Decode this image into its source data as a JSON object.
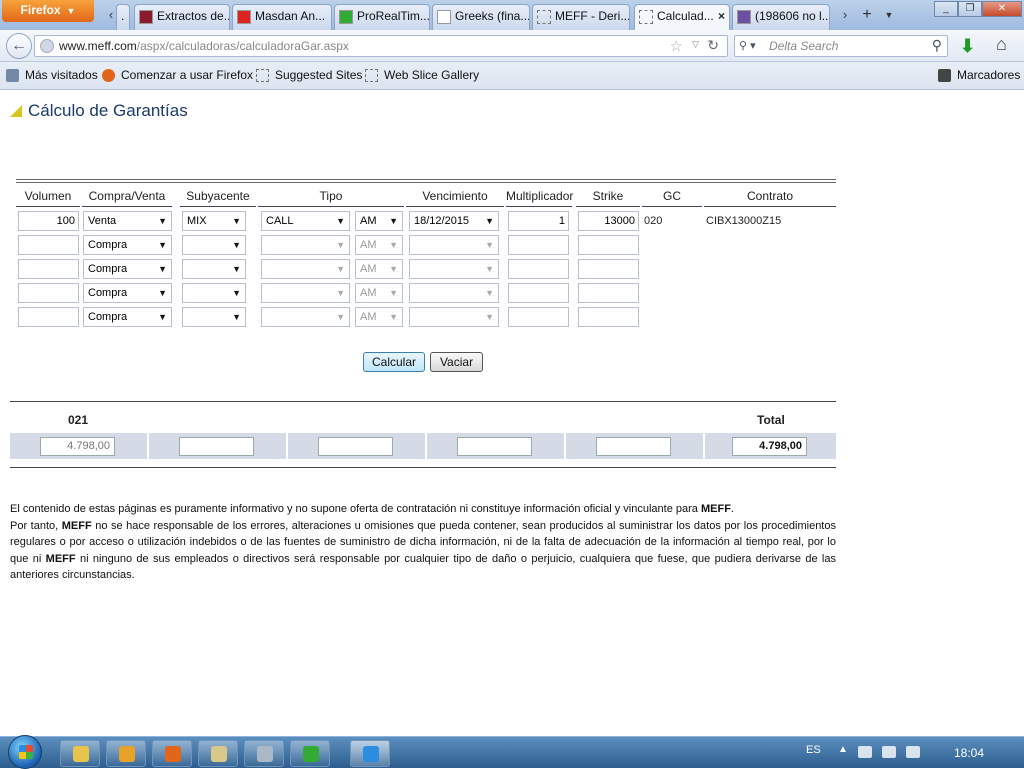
{
  "browser": {
    "firefox_menu": "Firefox",
    "tabs": [
      {
        "label": ".",
        "icon": "blank-page-icon"
      },
      {
        "label": "Extractos de...",
        "icon": "r4-icon"
      },
      {
        "label": "Masdan An...",
        "icon": "youtube-icon"
      },
      {
        "label": "ProRealTim...",
        "icon": "candlestick-icon"
      },
      {
        "label": "Greeks (fina...",
        "icon": "wikipedia-icon"
      },
      {
        "label": "MEFF - Deri...",
        "icon": "blank-page-icon"
      },
      {
        "label": "Calculad...",
        "icon": "blank-page-icon",
        "active": true
      },
      {
        "label": "(198606 no l...",
        "icon": "mail-icon"
      }
    ],
    "url_host": "www.meff.com",
    "url_path": "/aspx/calculadoras/calculadoraGar.aspx",
    "search_placeholder": "Delta Search",
    "bookmarks": [
      {
        "label": "Más visitados",
        "icon": "gear-icon"
      },
      {
        "label": "Comenzar a usar Firefox",
        "icon": "firefox-icon"
      },
      {
        "label": "Suggested Sites",
        "icon": "blank-page-icon"
      },
      {
        "label": "Web Slice Gallery",
        "icon": "blank-page-icon"
      }
    ],
    "bookmarks_menu": "Marcadores"
  },
  "page": {
    "title": "Cálculo de Garantías",
    "columns": [
      "Volumen",
      "Compra/Venta",
      "Subyacente",
      "Tipo",
      "Vencimiento",
      "Multiplicador",
      "Strike",
      "GC",
      "Contrato"
    ],
    "rows": [
      {
        "volumen": "100",
        "compra_venta": "Venta",
        "subyacente": "MIX",
        "tipo": "CALL",
        "estilo": "AM",
        "vencimiento": "18/12/2015",
        "multiplicador": "1",
        "strike": "13000",
        "gc": "020",
        "contrato": "CIBX13000Z15"
      },
      {
        "volumen": "",
        "compra_venta": "Compra",
        "subyacente": "",
        "tipo": "",
        "estilo": "AM",
        "vencimiento": "",
        "multiplicador": "",
        "strike": "",
        "gc": "",
        "contrato": ""
      },
      {
        "volumen": "",
        "compra_venta": "Compra",
        "subyacente": "",
        "tipo": "",
        "estilo": "AM",
        "vencimiento": "",
        "multiplicador": "",
        "strike": "",
        "gc": "",
        "contrato": ""
      },
      {
        "volumen": "",
        "compra_venta": "Compra",
        "subyacente": "",
        "tipo": "",
        "estilo": "AM",
        "vencimiento": "",
        "multiplicador": "",
        "strike": "",
        "gc": "",
        "contrato": ""
      },
      {
        "volumen": "",
        "compra_venta": "Compra",
        "subyacente": "",
        "tipo": "",
        "estilo": "AM",
        "vencimiento": "",
        "multiplicador": "",
        "strike": "",
        "gc": "",
        "contrato": ""
      }
    ],
    "buttons": {
      "calcular": "Calcular",
      "vaciar": "Vaciar"
    },
    "results": {
      "group_label": "021",
      "total_label": "Total",
      "values": [
        "4.798,00",
        "",
        "",
        "",
        ""
      ],
      "total": "4.798,00"
    },
    "disclaimer": [
      {
        "parts": [
          {
            "t": "El contenido de estas páginas es puramente informativo y no supone oferta de contratación ni constituye información oficial y vinculante para "
          },
          {
            "t": "MEFF",
            "b": true
          },
          {
            "t": "."
          }
        ]
      },
      {
        "parts": [
          {
            "t": "Por tanto, "
          },
          {
            "t": "MEFF",
            "b": true
          },
          {
            "t": " no se hace responsable de los errores, alteraciones u omisiones que pueda contener, sean producidos al suministrar los datos por los procedimientos regulares o por acceso o utilización indebidos o de las fuentes de suministro de dicha información, ni de la falta de adecuación de la información al tiempo real, por lo que ni "
          },
          {
            "t": "MEFF",
            "b": true
          },
          {
            "t": " ni ninguno de sus empleados o directivos será responsable por cualquier tipo de daño o perjuicio, cualquiera que fuese, que pudiera derivarse de las anteriores circunstancias."
          }
        ]
      }
    ]
  },
  "taskbar": {
    "apps": [
      "explorer-icon",
      "media-player-icon",
      "firefox-icon",
      "calculator-notes-icon",
      "calculator-icon",
      "candlestick-icon",
      "internet-explorer-icon"
    ],
    "language": "ES",
    "clock": "18:04"
  }
}
